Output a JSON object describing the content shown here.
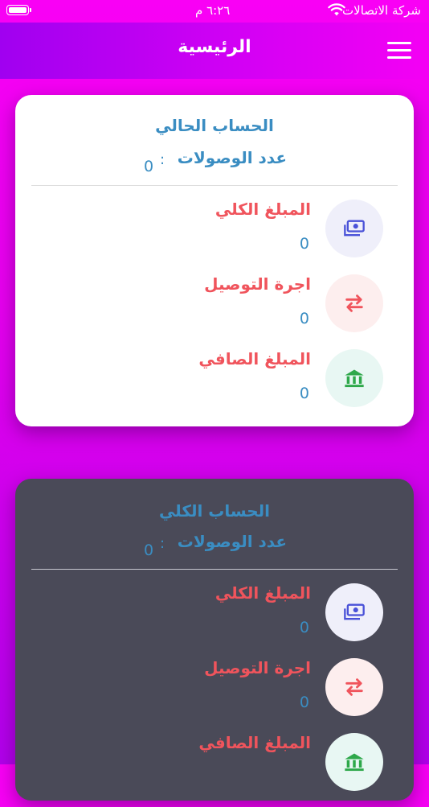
{
  "status_bar": {
    "carrier": "شركة الاتصالات",
    "time": "٦:٢٦ م"
  },
  "header": {
    "title": "الرئيسية"
  },
  "cards": [
    {
      "title": "الحساب الحالي",
      "count_label": "عدد الوصولات",
      "count_separator": ":",
      "count_value": "0",
      "rows": [
        {
          "label": "المبلغ الكلي",
          "value": "0",
          "icon": "money-icon"
        },
        {
          "label": "اجرة التوصيل",
          "value": "0",
          "icon": "swap-arrows-icon"
        },
        {
          "label": "المبلغ الصافي",
          "value": "0",
          "icon": "bank-icon"
        }
      ]
    },
    {
      "title": "الحساب الكلي",
      "count_label": "عدد الوصولات",
      "count_separator": ":",
      "count_value": "0",
      "rows": [
        {
          "label": "المبلغ الكلي",
          "value": "0",
          "icon": "money-icon"
        },
        {
          "label": "اجرة التوصيل",
          "value": "0",
          "icon": "swap-arrows-icon"
        },
        {
          "label": "المبلغ الصافي",
          "value": "",
          "icon": "bank-icon"
        }
      ]
    }
  ],
  "colors": {
    "accent_blue": "#3a8dc2",
    "label_red": "#f0545c",
    "icon_blue": "#4a52d8",
    "icon_red": "#f0545c",
    "icon_green": "#2ea84a",
    "dark_card": "#4a4a58"
  }
}
